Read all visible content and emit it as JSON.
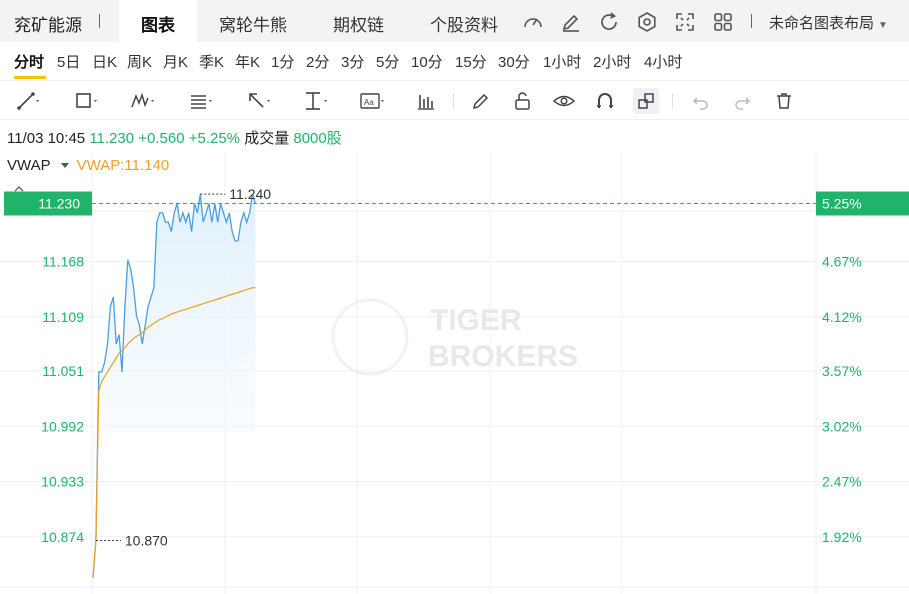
{
  "topbar": {
    "stock_name": "兖矿能源",
    "tabs": [
      {
        "label": "图表",
        "active": true
      },
      {
        "label": "窝轮牛熊",
        "active": false
      },
      {
        "label": "期权链",
        "active": false
      },
      {
        "label": "个股资料",
        "active": false
      }
    ],
    "icons": [
      "speedometer-icon",
      "pencil-icon",
      "refresh-icon",
      "gear-icon",
      "fullscreen-icon",
      "grid-icon"
    ],
    "layout_label": "未命名图表布局"
  },
  "periods": [
    "分时",
    "5日",
    "日K",
    "周K",
    "月K",
    "季K",
    "年K",
    "1分",
    "2分",
    "3分",
    "5分",
    "10分",
    "15分",
    "30分",
    "1小时",
    "2小时",
    "4小时"
  ],
  "active_period": "分时",
  "toolbar_icons": [
    "trend-line-icon",
    "rectangle-icon",
    "wave-pattern-icon",
    "fibonacci-icon",
    "arrow-icon",
    "price-range-icon",
    "text-annotation-icon",
    "indicator-icon",
    "brush-icon",
    "lock-icon",
    "eye-icon",
    "magnet-icon",
    "link-icon",
    "undo-icon",
    "redo-icon",
    "trash-icon"
  ],
  "info": {
    "datetime": "11/03 10:45",
    "price": "11.230",
    "change": "+0.560",
    "change_pct": "+5.25%",
    "volume_label": "成交量",
    "volume_value": "8000股"
  },
  "indicator": {
    "name": "VWAP",
    "value_label": "VWAP:11.140"
  },
  "watermark": {
    "line1": "TIGER",
    "line2": "BROKERS"
  },
  "colors": {
    "up": "#20b46a",
    "price_line": "#4a9fe0",
    "vwap_line": "#f0a020",
    "accent": "#f5c400",
    "price_area": "#dff0fb"
  },
  "chart_data": {
    "type": "line",
    "ylim": [
      10.815,
      11.285
    ],
    "y_ticks": [
      {
        "value": 11.168,
        "label": "11.168",
        "pct": "4.67%"
      },
      {
        "value": 11.109,
        "label": "11.109",
        "pct": "4.12%"
      },
      {
        "value": 11.051,
        "label": "11.051",
        "pct": "3.57%"
      },
      {
        "value": 10.992,
        "label": "10.992",
        "pct": "3.02%"
      },
      {
        "value": 10.933,
        "label": "10.933",
        "pct": "2.47%"
      },
      {
        "value": 10.874,
        "label": "10.874",
        "pct": "1.92%"
      }
    ],
    "last_price": {
      "value": 11.23,
      "label": "11.230",
      "pct": "5.25%"
    },
    "high": {
      "value": 11.24,
      "label": "11.240"
    },
    "low": {
      "value": 10.87,
      "label": "10.870"
    },
    "series": [
      {
        "name": "",
        "values": [
          10.83,
          10.87,
          11.05,
          11.05,
          11.06,
          11.08,
          11.12,
          11.13,
          11.08,
          11.09,
          11.05,
          11.12,
          11.17,
          11.16,
          11.14,
          11.11,
          11.1,
          11.08,
          11.1,
          11.12,
          11.13,
          11.14,
          11.21,
          11.22,
          11.22,
          11.21,
          11.21,
          11.2,
          11.22,
          11.23,
          11.21,
          11.22,
          11.21,
          11.22,
          11.2,
          11.23,
          11.22,
          11.24,
          11.21,
          11.22,
          11.23,
          11.21,
          11.23,
          11.21,
          11.23,
          11.22,
          11.21,
          11.22,
          11.2,
          11.19,
          11.19,
          11.21,
          11.22,
          11.21,
          11.22,
          11.24,
          11.23
        ]
      },
      {
        "name": "VWAP",
        "values": [
          10.83,
          10.87,
          11.03,
          11.04,
          11.045,
          11.05,
          11.055,
          11.06,
          11.065,
          11.07,
          11.073,
          11.076,
          11.08,
          11.083,
          11.086,
          11.088,
          11.09,
          11.092,
          11.095,
          11.098,
          11.1,
          11.102,
          11.104,
          11.106,
          11.107,
          11.109,
          11.11,
          11.112,
          11.113,
          11.114,
          11.115,
          11.116,
          11.117,
          11.118,
          11.119,
          11.12,
          11.121,
          11.122,
          11.123,
          11.124,
          11.125,
          11.126,
          11.127,
          11.128,
          11.129,
          11.13,
          11.131,
          11.132,
          11.133,
          11.134,
          11.135,
          11.136,
          11.137,
          11.138,
          11.139,
          11.14,
          11.14
        ]
      }
    ]
  }
}
